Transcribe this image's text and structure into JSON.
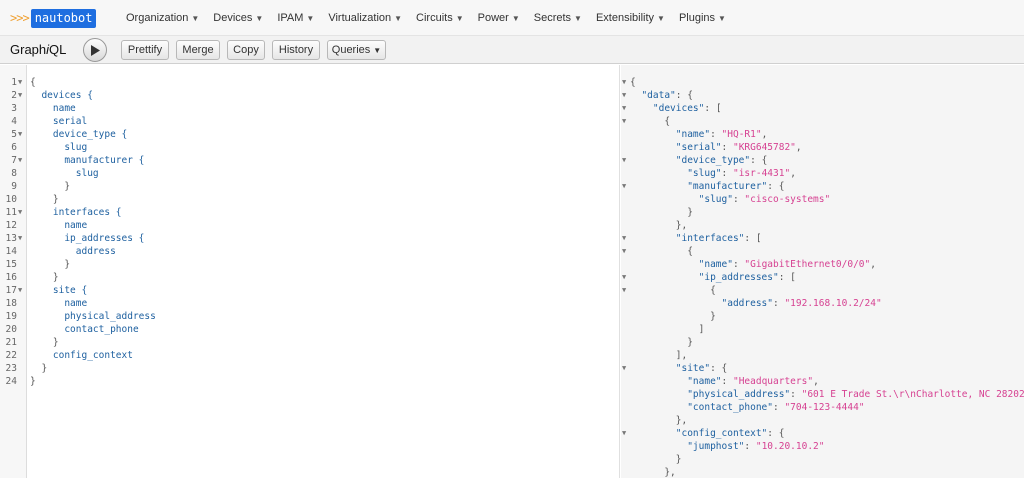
{
  "logo": {
    "chevrons": ">>>",
    "text": "nautobot"
  },
  "nav": [
    {
      "label": "Organization"
    },
    {
      "label": "Devices"
    },
    {
      "label": "IPAM"
    },
    {
      "label": "Virtualization"
    },
    {
      "label": "Circuits"
    },
    {
      "label": "Power"
    },
    {
      "label": "Secrets"
    },
    {
      "label": "Extensibility"
    },
    {
      "label": "Plugins"
    }
  ],
  "toolbar": {
    "title_prefix": "Graph",
    "title_i": "i",
    "title_suffix": "QL",
    "buttons": [
      {
        "label": "Prettify"
      },
      {
        "label": "Merge"
      },
      {
        "label": "Copy"
      },
      {
        "label": "History"
      },
      {
        "label": "Queries"
      }
    ]
  },
  "query_lines": [
    {
      "n": "1",
      "fold": true,
      "text": "{"
    },
    {
      "n": "2",
      "fold": true,
      "text": "  devices {"
    },
    {
      "n": "3",
      "fold": false,
      "text": "    name"
    },
    {
      "n": "4",
      "fold": false,
      "text": "    serial"
    },
    {
      "n": "5",
      "fold": true,
      "text": "    device_type {"
    },
    {
      "n": "6",
      "fold": false,
      "text": "      slug"
    },
    {
      "n": "7",
      "fold": true,
      "text": "      manufacturer {"
    },
    {
      "n": "8",
      "fold": false,
      "text": "        slug"
    },
    {
      "n": "9",
      "fold": false,
      "text": "      }"
    },
    {
      "n": "10",
      "fold": false,
      "text": "    }"
    },
    {
      "n": "11",
      "fold": true,
      "text": "    interfaces {"
    },
    {
      "n": "12",
      "fold": false,
      "text": "      name"
    },
    {
      "n": "13",
      "fold": true,
      "text": "      ip_addresses {"
    },
    {
      "n": "14",
      "fold": false,
      "text": "        address"
    },
    {
      "n": "15",
      "fold": false,
      "text": "      }"
    },
    {
      "n": "16",
      "fold": false,
      "text": "    }"
    },
    {
      "n": "17",
      "fold": true,
      "text": "    site {"
    },
    {
      "n": "18",
      "fold": false,
      "text": "      name"
    },
    {
      "n": "19",
      "fold": false,
      "text": "      physical_address"
    },
    {
      "n": "20",
      "fold": false,
      "text": "      contact_phone"
    },
    {
      "n": "21",
      "fold": false,
      "text": "    }"
    },
    {
      "n": "22",
      "fold": false,
      "text": "    config_context"
    },
    {
      "n": "23",
      "fold": false,
      "text": "  }"
    },
    {
      "n": "24",
      "fold": false,
      "text": "}"
    }
  ],
  "result_lines": [
    {
      "fold": true,
      "indent": "",
      "key": "",
      "sep": "",
      "value": "",
      "tail": "{"
    },
    {
      "fold": true,
      "indent": "  ",
      "key": "\"data\"",
      "sep": ": ",
      "value": "",
      "tail": "{"
    },
    {
      "fold": true,
      "indent": "    ",
      "key": "\"devices\"",
      "sep": ": ",
      "value": "",
      "tail": "["
    },
    {
      "fold": true,
      "indent": "      ",
      "key": "",
      "sep": "",
      "value": "",
      "tail": "{"
    },
    {
      "fold": false,
      "indent": "        ",
      "key": "\"name\"",
      "sep": ": ",
      "value": "\"HQ-R1\"",
      "tail": ","
    },
    {
      "fold": false,
      "indent": "        ",
      "key": "\"serial\"",
      "sep": ": ",
      "value": "\"KRG645782\"",
      "tail": ","
    },
    {
      "fold": true,
      "indent": "        ",
      "key": "\"device_type\"",
      "sep": ": ",
      "value": "",
      "tail": "{"
    },
    {
      "fold": false,
      "indent": "          ",
      "key": "\"slug\"",
      "sep": ": ",
      "value": "\"isr-4431\"",
      "tail": ","
    },
    {
      "fold": true,
      "indent": "          ",
      "key": "\"manufacturer\"",
      "sep": ": ",
      "value": "",
      "tail": "{"
    },
    {
      "fold": false,
      "indent": "            ",
      "key": "\"slug\"",
      "sep": ": ",
      "value": "\"cisco-systems\"",
      "tail": ""
    },
    {
      "fold": false,
      "indent": "          ",
      "key": "",
      "sep": "",
      "value": "",
      "tail": "}"
    },
    {
      "fold": false,
      "indent": "        ",
      "key": "",
      "sep": "",
      "value": "",
      "tail": "},"
    },
    {
      "fold": true,
      "indent": "        ",
      "key": "\"interfaces\"",
      "sep": ": ",
      "value": "",
      "tail": "["
    },
    {
      "fold": true,
      "indent": "          ",
      "key": "",
      "sep": "",
      "value": "",
      "tail": "{"
    },
    {
      "fold": false,
      "indent": "            ",
      "key": "\"name\"",
      "sep": ": ",
      "value": "\"GigabitEthernet0/0/0\"",
      "tail": ","
    },
    {
      "fold": true,
      "indent": "            ",
      "key": "\"ip_addresses\"",
      "sep": ": ",
      "value": "",
      "tail": "["
    },
    {
      "fold": true,
      "indent": "              ",
      "key": "",
      "sep": "",
      "value": "",
      "tail": "{"
    },
    {
      "fold": false,
      "indent": "                ",
      "key": "\"address\"",
      "sep": ": ",
      "value": "\"192.168.10.2/24\"",
      "tail": ""
    },
    {
      "fold": false,
      "indent": "              ",
      "key": "",
      "sep": "",
      "value": "",
      "tail": "}"
    },
    {
      "fold": false,
      "indent": "            ",
      "key": "",
      "sep": "",
      "value": "",
      "tail": "]"
    },
    {
      "fold": false,
      "indent": "          ",
      "key": "",
      "sep": "",
      "value": "",
      "tail": "}"
    },
    {
      "fold": false,
      "indent": "        ",
      "key": "",
      "sep": "",
      "value": "",
      "tail": "],"
    },
    {
      "fold": true,
      "indent": "        ",
      "key": "\"site\"",
      "sep": ": ",
      "value": "",
      "tail": "{"
    },
    {
      "fold": false,
      "indent": "          ",
      "key": "\"name\"",
      "sep": ": ",
      "value": "\"Headquarters\"",
      "tail": ","
    },
    {
      "fold": false,
      "indent": "          ",
      "key": "\"physical_address\"",
      "sep": ": ",
      "value": "\"601 E Trade St.\\r\\nCharlotte, NC 28202\"",
      "tail": ","
    },
    {
      "fold": false,
      "indent": "          ",
      "key": "\"contact_phone\"",
      "sep": ": ",
      "value": "\"704-123-4444\"",
      "tail": ""
    },
    {
      "fold": false,
      "indent": "        ",
      "key": "",
      "sep": "",
      "value": "",
      "tail": "},"
    },
    {
      "fold": true,
      "indent": "        ",
      "key": "\"config_context\"",
      "sep": ": ",
      "value": "",
      "tail": "{"
    },
    {
      "fold": false,
      "indent": "          ",
      "key": "\"jumphost\"",
      "sep": ": ",
      "value": "\"10.20.10.2\"",
      "tail": ""
    },
    {
      "fold": false,
      "indent": "        ",
      "key": "",
      "sep": "",
      "value": "",
      "tail": "}"
    },
    {
      "fold": false,
      "indent": "      ",
      "key": "",
      "sep": "",
      "value": "",
      "tail": "},"
    }
  ]
}
